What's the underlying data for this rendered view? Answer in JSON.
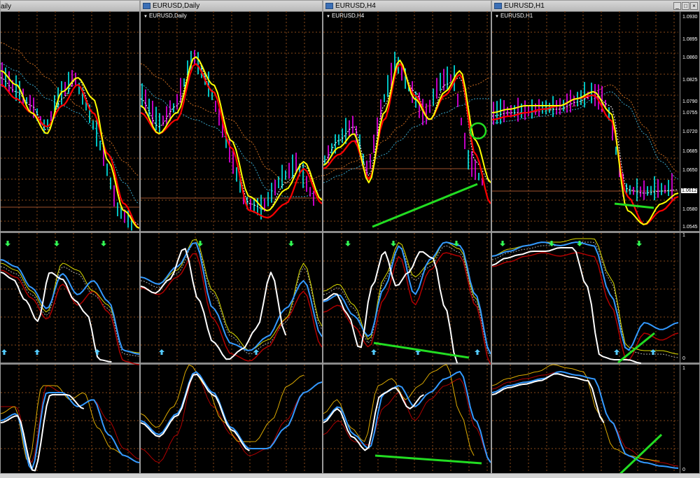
{
  "windows": [
    {
      "title": "",
      "label": "aily",
      "btns": []
    },
    {
      "title": "EURUSD,Daily",
      "label": "EURUSD,Daily",
      "btns": []
    },
    {
      "title": "EURUSD,H4",
      "label": "EURUSD,H4",
      "btns": []
    },
    {
      "title": "EURUSD,H1",
      "label": "EURUSD,H1",
      "btns": [
        "_",
        "□",
        "×"
      ]
    }
  ],
  "price_axis": {
    "labels": [
      "1.0930",
      "1.0895",
      "1.0860",
      "1.0825",
      "1.0790",
      "1.0755",
      "1.0720",
      "1.0685",
      "1.0650",
      "1.0612",
      "1.0580",
      "1.0545"
    ],
    "current_price": "1.0612"
  },
  "osc_axis": {
    "top": "1",
    "bottom": "0"
  },
  "colors": {
    "background": "#000000",
    "grid": "#8a4a1a",
    "price_up": "#00ffff",
    "price_down": "#ff00ff",
    "ma_fast": "#ffff00",
    "ma_slow": "#ff0000",
    "stoch_main": "#3399ff",
    "stoch_signal": "#ffffff",
    "trendline": "#22dd22",
    "arrow": "#33ff55"
  }
}
